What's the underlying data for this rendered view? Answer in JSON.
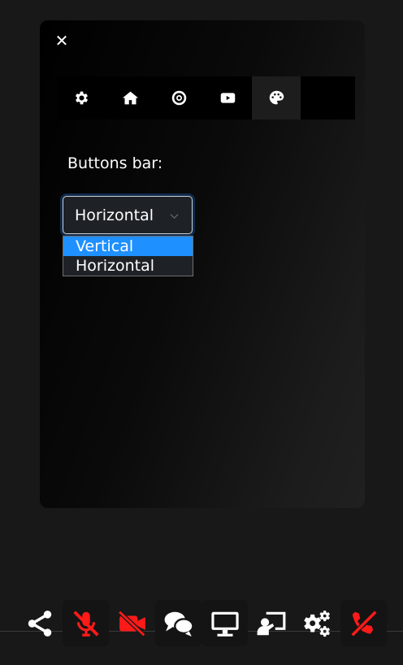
{
  "panel": {
    "close_symbol": "✕",
    "tabs": [
      {
        "name": "gear-icon",
        "active": false
      },
      {
        "name": "home-icon",
        "active": false
      },
      {
        "name": "target-icon",
        "active": false
      },
      {
        "name": "youtube-icon",
        "active": false
      },
      {
        "name": "palette-icon",
        "active": true
      }
    ],
    "buttons_bar_label": "Buttons bar:",
    "select": {
      "value": "Horizontal",
      "options": [
        "Vertical",
        "Horizontal"
      ],
      "highlighted": "Vertical"
    }
  },
  "toolbar": {
    "buttons": [
      {
        "name": "share-icon",
        "muted": false
      },
      {
        "name": "microphone-off-icon",
        "muted": true
      },
      {
        "name": "camera-off-icon",
        "muted": true
      },
      {
        "name": "chat-icon",
        "muted": false
      },
      {
        "name": "screen-share-icon",
        "muted": false
      },
      {
        "name": "presenter-icon",
        "muted": false
      },
      {
        "name": "settings-icon",
        "muted": false
      },
      {
        "name": "hangup-icon",
        "muted": true
      }
    ]
  },
  "colors": {
    "accent": "#1e90ff",
    "muted_red": "#ff1a1a",
    "panel_bg": "#000000",
    "page_bg": "#181818"
  }
}
